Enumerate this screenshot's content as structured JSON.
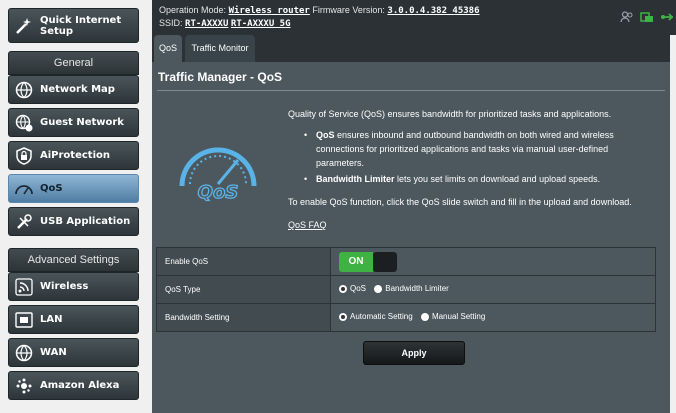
{
  "sidebar": {
    "quick_setup": "Quick Internet Setup",
    "general_header": "General",
    "general_items": [
      {
        "label": "Network Map",
        "icon": "globe-icon"
      },
      {
        "label": "Guest Network",
        "icon": "guest-globe-icon"
      },
      {
        "label": "AiProtection",
        "icon": "lock-icon"
      },
      {
        "label": "QoS",
        "icon": "speedometer-icon"
      },
      {
        "label": "USB Application",
        "icon": "usb-tools-icon"
      }
    ],
    "advanced_header": "Advanced Settings",
    "advanced_items": [
      {
        "label": "Wireless",
        "icon": "wifi-icon"
      },
      {
        "label": "LAN",
        "icon": "lan-icon"
      },
      {
        "label": "WAN",
        "icon": "globe-icon"
      },
      {
        "label": "Amazon Alexa",
        "icon": "alexa-icon"
      }
    ]
  },
  "topbar": {
    "op_mode_label": "Operation Mode:",
    "op_mode_value": "Wireless router",
    "firmware_label": "Firmware Version:",
    "firmware_value": "3.0.0.4.382_45386",
    "ssid_label": "SSID:",
    "ssid_1": "RT-AXXXU",
    "ssid_2": "RT-AXXXU_5G"
  },
  "tabs": [
    {
      "label": "QoS",
      "active": true
    },
    {
      "label": "Traffic Monitor",
      "active": false
    }
  ],
  "main": {
    "title": "Traffic Manager - QoS",
    "intro": "Quality of Service (QoS) ensures bandwidth for prioritized tasks and applications.",
    "bullet1_bold": "QoS",
    "bullet1_text": " ensures inbound and outbound bandwidth on both wired and wireless connections for prioritized applications and tasks via manual user-defined parameters.",
    "bullet2_bold": "Bandwidth Limiter",
    "bullet2_text": " lets you set limits on download and upload speeds.",
    "enable_note": "To enable QoS function, click the QoS slide switch and fill in the upload and download.",
    "faq": "QoS FAQ",
    "logo_text": "QoS"
  },
  "settings": {
    "enable_label": "Enable QoS",
    "toggle_label": "ON",
    "type_label": "QoS Type",
    "type_options": [
      "QoS",
      "Bandwidth Limiter"
    ],
    "type_selected": "QoS",
    "bw_label": "Bandwidth Setting",
    "bw_options": [
      "Automatic Setting",
      "Manual Setting"
    ],
    "bw_selected": "Automatic Setting"
  },
  "apply_label": "Apply",
  "colors": {
    "accent_green": "#3fb244",
    "active_blue": "#6f9cc2",
    "panel": "#4d585e"
  }
}
